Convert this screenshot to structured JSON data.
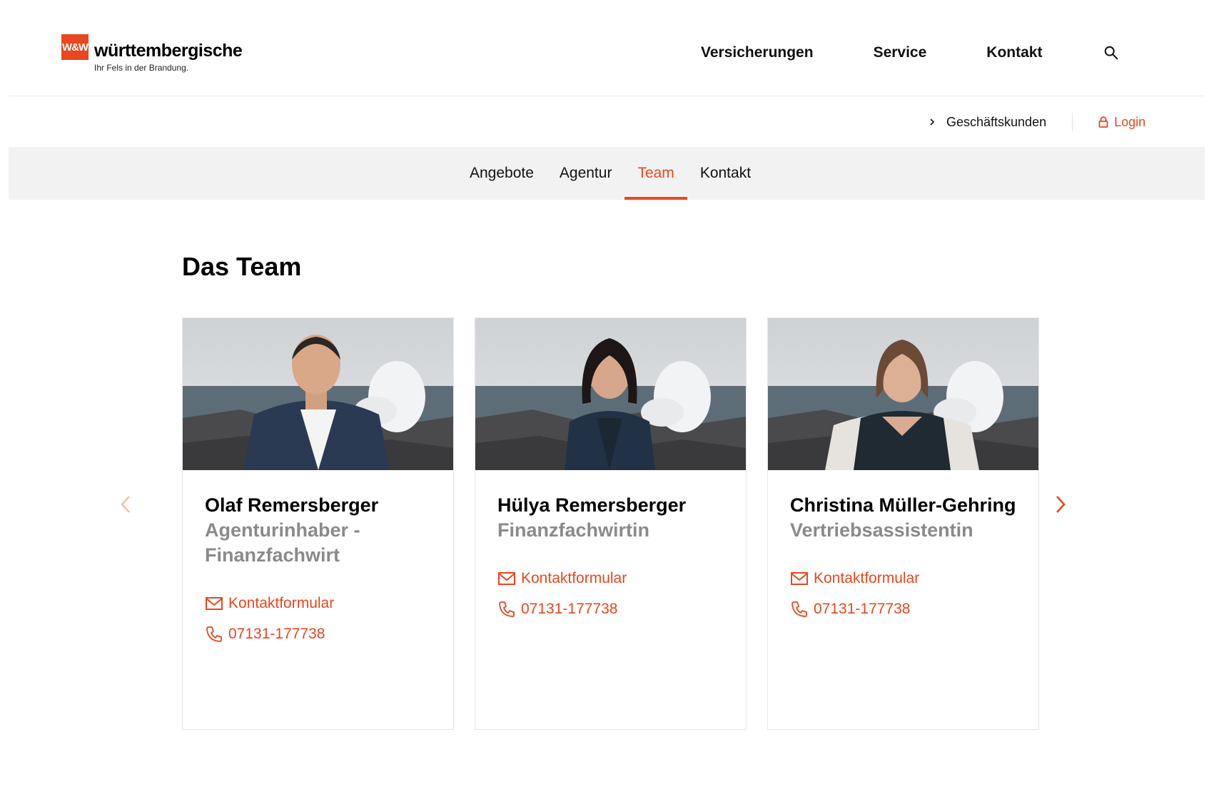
{
  "brand": {
    "logo_mark": "W&W",
    "name": "württembergische",
    "claim": "Ihr Fels in der Brandung.",
    "accent_color": "#e8471f"
  },
  "main_nav": [
    {
      "label": "Versicherungen"
    },
    {
      "label": "Service"
    },
    {
      "label": "Kontakt"
    }
  ],
  "utility": {
    "business_label": "Geschäftskunden",
    "login_label": "Login"
  },
  "sub_nav": [
    {
      "label": "Angebote",
      "active": false
    },
    {
      "label": "Agentur",
      "active": false
    },
    {
      "label": "Team",
      "active": true
    },
    {
      "label": "Kontakt",
      "active": false
    }
  ],
  "section": {
    "title": "Das Team"
  },
  "team": [
    {
      "name": "Olaf Remersberger",
      "role": "Agenturinhaber - Finanzfachwirt",
      "contact_form_label": "Kontaktformular",
      "phone": "07131-177738"
    },
    {
      "name": "Hülya Remersberger",
      "role": "Finanzfachwirtin",
      "contact_form_label": "Kontaktformular",
      "phone": "07131-177738"
    },
    {
      "name": "Christina Müller-Gehring",
      "role": "Vertriebsassistentin",
      "contact_form_label": "Kontaktformular",
      "phone": "07131-177738"
    }
  ]
}
